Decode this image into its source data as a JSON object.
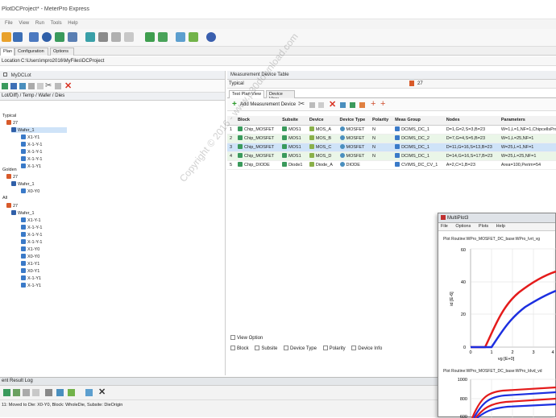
{
  "window": {
    "title": "PlotDCProject* - MeterPro Express"
  },
  "menu": [
    "File",
    "View",
    "Run",
    "Tools",
    "Help"
  ],
  "tabs": [
    {
      "label": "Plan"
    },
    {
      "label": "Configuration"
    },
    {
      "label": "Options"
    }
  ],
  "location": {
    "label": "Location",
    "value": "C:\\Users\\mpro2016\\MyFiles\\DCProject"
  },
  "left_panel": {
    "title": "MyDCLot",
    "hierarchy_label": "Lot/Diff) / Temp / Wafer / Dies",
    "groups": [
      {
        "name": "Typical",
        "temp": "27",
        "wafer": "Wafer_1",
        "dies": [
          "X1-Y1",
          "X-1-Y-1",
          "X-1-Y-1",
          "X-1-Y-1",
          "X-1-Y1"
        ]
      },
      {
        "name": "Golden",
        "temp": "27",
        "wafer": "Wafer_1",
        "dies": [
          "X0-Y0"
        ]
      },
      {
        "name": "All",
        "temp": "27",
        "wafer": "Wafer_1",
        "dies": [
          "X1-Y-1",
          "X-1-Y-1",
          "X-1-Y-1",
          "X-1-Y-1",
          "X1-Y0",
          "X0-Y0",
          "X1-Y1",
          "X0-Y1",
          "X-1-Y1",
          "X-1-Y1"
        ]
      }
    ]
  },
  "right_panel": {
    "title": "Measurement Device Table",
    "filter": "Typical",
    "temp": "27",
    "subtabs": [
      {
        "label": "Test Plan View"
      },
      {
        "label": "Device View"
      }
    ],
    "add_button": "Add Measurement Device",
    "columns": [
      "Block",
      "Subsite",
      "Device",
      "Device Type",
      "Polarity",
      "Meas Group",
      "Nodes",
      "Parameters"
    ],
    "rows": [
      {
        "n": "1",
        "block": "Chip_MOSFET",
        "subsite": "MOS1",
        "device": "MOS_A",
        "type": "MOSFET",
        "pol": "N",
        "group": "DCIMS_DC_1",
        "nodes": "D=1,G=2,S=3,B=23",
        "params": "W=1,L=1,NF=1,ChipcellsProf"
      },
      {
        "n": "2",
        "block": "Chip_MOSFET",
        "subsite": "MOS1",
        "device": "MOS_B",
        "type": "MOSFET",
        "pol": "N",
        "group": "DCIMS_DC_2",
        "nodes": "D=7,G=4,S=5,B=23",
        "params": "W=1,L=25,NF=1"
      },
      {
        "n": "3",
        "block": "Chip_MOSFET",
        "subsite": "MOS1",
        "device": "MOS_C",
        "type": "MOSFET",
        "pol": "N",
        "group": "DCIMS_DC_1",
        "nodes": "D=11,G=16,S=13,B=23",
        "params": "W=25,L=1,NF=1"
      },
      {
        "n": "4",
        "block": "Chip_MOSFET",
        "subsite": "MOS1",
        "device": "MOS_D",
        "type": "MOSFET",
        "pol": "N",
        "group": "DCIMS_DC_1",
        "nodes": "D=14,G=16,S=17,B=23",
        "params": "W=25,L=25,NF=1"
      },
      {
        "n": "5",
        "block": "Chip_DIODE",
        "subsite": "Diode1",
        "device": "Diode_A",
        "type": "DIODE",
        "pol": "",
        "group": "CVIMS_DC_CV_1",
        "nodes": "A=2,C=1,B=23",
        "params": "Area=100,Perim=54"
      }
    ],
    "view_option": "View Option",
    "checkboxes": [
      "Block",
      "Subsite",
      "Device Type",
      "Polarity",
      "Device Info"
    ]
  },
  "log": {
    "title": "ent Result Log",
    "message": "11: Moved to Die: X0-Y0, Block: WholeDie, Subsite: DieOrigin"
  },
  "plot_window": {
    "title": "MultiPlot3",
    "menu": [
      "File",
      "Options",
      "Plots",
      "Help"
    ],
    "plot1": {
      "title": "Plot Routine:WPro_MOSFET_DC_base:WPro_Ivrt_vg",
      "ylabel": "id  [E-6]",
      "xlabel": "vg  [E+0]",
      "yticks": [
        "60",
        "40",
        "20",
        "0"
      ],
      "xticks": [
        "0",
        "1",
        "2",
        "3",
        "4"
      ]
    },
    "plot2": {
      "title": "Plot Routine:WPro_MOSFET_DC_base:WPro_Idvd_vd",
      "yticks": [
        "1000",
        "800",
        "600"
      ]
    }
  },
  "watermark": "Copyright © 2016 - www.p30download.com"
}
